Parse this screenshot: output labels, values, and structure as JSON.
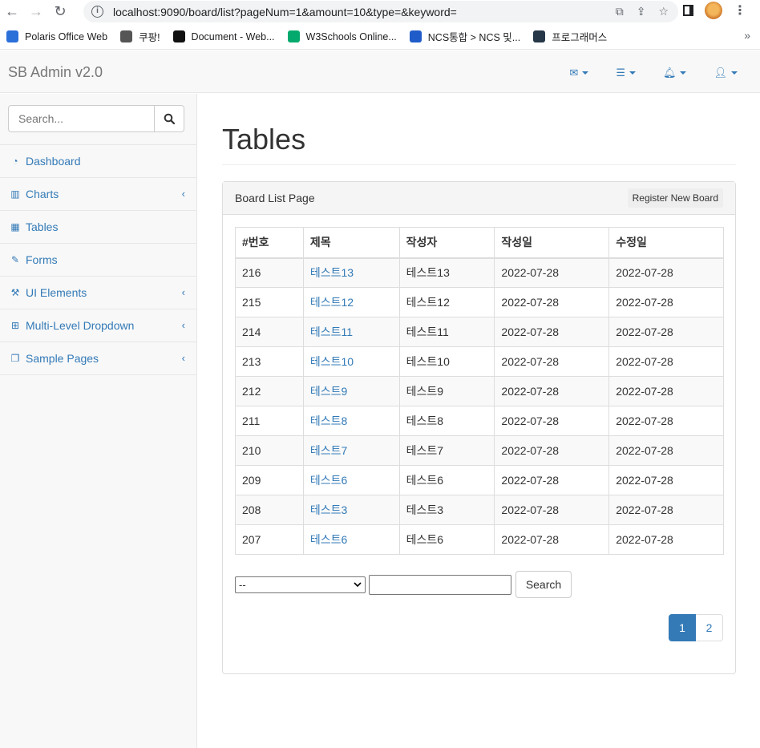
{
  "browser": {
    "url": "localhost:9090/board/list?pageNum=1&amount=10&type=&keyword=",
    "bookmarks": [
      {
        "label": "Polaris Office Web",
        "color": "#2b6fd9"
      },
      {
        "label": "쿠팡!",
        "color": "#555555"
      },
      {
        "label": "Document - Web...",
        "color": "#111111"
      },
      {
        "label": "W3Schools Online...",
        "color": "#04aa6d"
      },
      {
        "label": "NCS통합 > NCS 및...",
        "color": "#1f5cc9"
      },
      {
        "label": "프로그래머스",
        "color": "#263747"
      }
    ],
    "more": "»"
  },
  "navbar": {
    "brand": "SB Admin v2.0",
    "icons": [
      "envelope-icon",
      "tasks-icon",
      "bell-icon",
      "user-icon"
    ]
  },
  "sidebar": {
    "search_placeholder": "Search...",
    "items": [
      {
        "label": "Dashboard",
        "icon": "dashboard-icon",
        "glyph": "◔",
        "chevron": false
      },
      {
        "label": "Charts",
        "icon": "bar-chart-icon",
        "glyph": "▥",
        "chevron": true
      },
      {
        "label": "Tables",
        "icon": "table-icon",
        "glyph": "▦",
        "chevron": false
      },
      {
        "label": "Forms",
        "icon": "edit-icon",
        "glyph": "✎",
        "chevron": false
      },
      {
        "label": "UI Elements",
        "icon": "wrench-icon",
        "glyph": "⚒",
        "chevron": true
      },
      {
        "label": "Multi-Level Dropdown",
        "icon": "sitemap-icon",
        "glyph": "⊞",
        "chevron": true
      },
      {
        "label": "Sample Pages",
        "icon": "files-icon",
        "glyph": "❐",
        "chevron": true
      }
    ]
  },
  "main": {
    "title": "Tables",
    "panel_title": "Board List Page",
    "register_label": "Register New Board",
    "columns": [
      "#번호",
      "제목",
      "작성자",
      "작성일",
      "수정일"
    ],
    "rows": [
      [
        "216",
        "테스트13",
        "테스트13",
        "2022-07-28",
        "2022-07-28"
      ],
      [
        "215",
        "테스트12",
        "테스트12",
        "2022-07-28",
        "2022-07-28"
      ],
      [
        "214",
        "테스트11",
        "테스트11",
        "2022-07-28",
        "2022-07-28"
      ],
      [
        "213",
        "테스트10",
        "테스트10",
        "2022-07-28",
        "2022-07-28"
      ],
      [
        "212",
        "테스트9",
        "테스트9",
        "2022-07-28",
        "2022-07-28"
      ],
      [
        "211",
        "테스트8",
        "테스트8",
        "2022-07-28",
        "2022-07-28"
      ],
      [
        "210",
        "테스트7",
        "테스트7",
        "2022-07-28",
        "2022-07-28"
      ],
      [
        "209",
        "테스트6",
        "테스트6",
        "2022-07-28",
        "2022-07-28"
      ],
      [
        "208",
        "테스트3",
        "테스트3",
        "2022-07-28",
        "2022-07-28"
      ],
      [
        "207",
        "테스트6",
        "테스트6",
        "2022-07-28",
        "2022-07-28"
      ]
    ],
    "type_select_value": "--",
    "keyword_value": "",
    "search_label": "Search",
    "pages": [
      "1",
      "2"
    ],
    "active_page": "1",
    "link_color": "#337ab7"
  }
}
